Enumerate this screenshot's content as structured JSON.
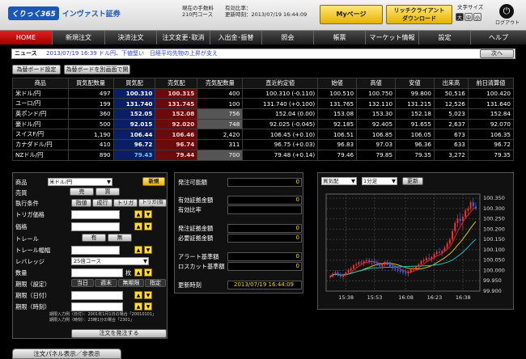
{
  "header": {
    "logo_mark": "くりっく365",
    "logo_text": "インヴァスト証券",
    "fee_label": "現在の手数料",
    "fee_value": "210円コース",
    "margin_label": "有効比率：",
    "updated_label": "更新時刻：2013/07/19 16:44:09",
    "mypage": "Myページ",
    "rich_client_1": "リッチクライアント",
    "rich_client_2": "ダウンロード",
    "font_size_label": "文字サイズ",
    "font_sizes": [
      "大",
      "中",
      "小"
    ],
    "logout": "ログアウト"
  },
  "nav": [
    {
      "label": "HOME"
    },
    {
      "label": "新規注文"
    },
    {
      "label": "決済注文"
    },
    {
      "label": "注文変更･取消"
    },
    {
      "label": "入出金･振替"
    },
    {
      "label": "照会"
    },
    {
      "label": "帳票"
    },
    {
      "label": "マーケット情報"
    },
    {
      "label": "設定"
    },
    {
      "label": "ヘルプ"
    }
  ],
  "news": {
    "label": "ニュース",
    "text": "2013/07/19 16:39 ドル円、下値堅い　日経平均先物の上昇が支え",
    "next": "次へ"
  },
  "board_buttons": [
    "為替ボード設定",
    "為替ボードを別画面で開く"
  ],
  "quotes": {
    "headers": [
      "商品",
      "買気配数量",
      "買気配",
      "売気配",
      "売気配数量",
      "直近約定値",
      "始値",
      "高値",
      "安値",
      "出来高",
      "前日清算値"
    ],
    "rows": [
      [
        "米ドル/円",
        "497",
        "100.310",
        "100.315",
        "400",
        "100.310 (-0.110)",
        "100.510",
        "100.750",
        "99.800",
        "50,516",
        "100.420"
      ],
      [
        "ユーロ/円",
        "199",
        "131.740",
        "131.745",
        "100",
        "131.740 (+0.100)",
        "131.765",
        "132.110",
        "131.215",
        "12,526",
        "131.640"
      ],
      [
        "英ポンド/円",
        "360",
        "152.05",
        "152.08",
        "756",
        "152.04 (0.00)",
        "153.08",
        "153.30",
        "152.18",
        "5,023",
        "152.84"
      ],
      [
        "豪ドル/円",
        "500",
        "92.015",
        "92.020",
        "748",
        "92.025 (-0.045)",
        "92.185",
        "92.405",
        "91.655",
        "2,637",
        "92.070"
      ],
      [
        "スイスF/円",
        "1,190",
        "106.44",
        "106.46",
        "2,420",
        "106.45 (+0.10)",
        "106.51",
        "106.85",
        "106.05",
        "673",
        "106.35"
      ],
      [
        "カナダドル/円",
        "410",
        "96.72",
        "96.74",
        "311",
        "96.75 (+0.03)",
        "96.83",
        "97.03",
        "96.36",
        "633",
        "96.72"
      ],
      [
        "NZドル/円",
        "890",
        "79.43",
        "79.44",
        "700",
        "79.48 (+0.14)",
        "79.46",
        "79.85",
        "79.35",
        "3,272",
        "79.35"
      ]
    ]
  },
  "order": {
    "product_label": "商品",
    "product_value": "米ドル/円",
    "new_button": "新規",
    "side_label": "売買",
    "sell": "売",
    "buy": "買",
    "exec_label": "執行条件",
    "exec_opts": [
      "指値",
      "成行",
      "トリガ",
      "トリガ(指値)"
    ],
    "trigger_label": "トリガ価格",
    "price_label": "価格",
    "trail_label": "トレール",
    "trail_opts": [
      "有",
      "無"
    ],
    "trail_width_label": "トレール幅幅",
    "leverage_label": "レバレッジ",
    "leverage_value": "25倍コース",
    "qty_label": "数量",
    "qty_unit": "枚",
    "period_set_label": "期限（設定）",
    "period_opts": [
      "当日",
      "週末",
      "無期限",
      "指定"
    ],
    "period_day_label": "期限（日付）",
    "period_time_label": "期限（時刻）",
    "note1": "期限入力例（日付）：2001年1月1日の場合「20010101」",
    "note2": "期限入力例（時刻）：23時1分の場合「2301」",
    "submit": "注文を発注する"
  },
  "account": {
    "orderable_label": "発注可能額",
    "orderable": "0",
    "eff_margin_label": "有効証拠金額",
    "eff_margin": "0",
    "eff_ratio_label": "有効比率",
    "order_margin_label": "発注証拠金額",
    "order_margin": "0",
    "req_margin_label": "必要証拠金額",
    "req_margin": "0",
    "alert_label": "アラート基準額",
    "alert": "0",
    "losscut_label": "ロスカット基準額",
    "losscut": "0",
    "updated_label": "更新時刻",
    "updated": "2013/07/19 16:44:09"
  },
  "chart": {
    "side": "買気配",
    "interval": "1分足",
    "update": "更新",
    "yticks": [
      "100.350",
      "100.300",
      "100.250",
      "100.200",
      "100.150",
      "100.100",
      "100.050",
      "100.000",
      "99.950",
      "99.900"
    ],
    "xticks": [
      "15:38",
      "15:53",
      "16:08",
      "16:23",
      "16:38"
    ]
  },
  "chart_data": {
    "type": "candlestick",
    "x_start": "15:30",
    "x_end": "16:44",
    "ylim": [
      99.9,
      100.37
    ],
    "candles": [
      [
        99.97,
        99.98,
        99.96,
        99.97
      ],
      [
        99.97,
        99.99,
        99.965,
        99.985
      ],
      [
        99.985,
        100.0,
        99.975,
        99.99
      ],
      [
        99.99,
        100.0,
        99.97,
        99.975
      ],
      [
        99.975,
        99.99,
        99.96,
        99.97
      ],
      [
        99.97,
        99.985,
        99.955,
        99.98
      ],
      [
        99.98,
        99.995,
        99.97,
        99.99
      ],
      [
        99.99,
        100.01,
        99.98,
        100.0
      ],
      [
        100.0,
        100.02,
        99.99,
        100.01
      ],
      [
        100.01,
        100.03,
        100.0,
        100.025
      ],
      [
        100.025,
        100.04,
        100.015,
        100.03
      ],
      [
        100.03,
        100.045,
        100.02,
        100.04
      ],
      [
        100.04,
        100.05,
        100.025,
        100.035
      ],
      [
        100.035,
        100.05,
        100.02,
        100.045
      ],
      [
        100.045,
        100.06,
        100.03,
        100.05
      ],
      [
        100.05,
        100.06,
        100.03,
        100.04
      ],
      [
        100.04,
        100.055,
        100.025,
        100.045
      ],
      [
        100.045,
        100.06,
        100.03,
        100.035
      ],
      [
        100.035,
        100.05,
        100.02,
        100.025
      ],
      [
        100.025,
        100.04,
        100.01,
        100.02
      ],
      [
        100.02,
        100.035,
        100.005,
        100.03
      ],
      [
        100.03,
        100.045,
        100.02,
        100.04
      ],
      [
        100.04,
        100.05,
        100.025,
        100.03
      ],
      [
        100.03,
        100.045,
        100.015,
        100.02
      ],
      [
        100.02,
        100.03,
        100.0,
        100.01
      ],
      [
        100.01,
        100.025,
        99.995,
        100.005
      ],
      [
        100.005,
        100.02,
        99.99,
        100.0
      ],
      [
        100.0,
        100.015,
        99.985,
        99.995
      ],
      [
        99.995,
        100.01,
        99.98,
        99.99
      ],
      [
        99.99,
        100.005,
        99.975,
        99.985
      ],
      [
        99.985,
        100.0,
        99.97,
        99.99
      ],
      [
        99.99,
        100.01,
        99.985,
        100.005
      ],
      [
        100.005,
        100.02,
        99.995,
        100.01
      ],
      [
        100.01,
        100.025,
        100.0,
        100.02
      ],
      [
        100.02,
        100.035,
        100.01,
        100.03
      ],
      [
        100.03,
        100.05,
        100.02,
        100.045
      ],
      [
        100.045,
        100.06,
        100.035,
        100.05
      ],
      [
        100.05,
        100.07,
        100.04,
        100.06
      ],
      [
        100.06,
        100.08,
        100.05,
        100.055
      ],
      [
        100.055,
        100.07,
        100.04,
        100.065
      ],
      [
        100.065,
        100.09,
        100.055,
        100.08
      ],
      [
        100.08,
        100.1,
        100.07,
        100.09
      ],
      [
        100.09,
        100.11,
        100.08,
        100.085
      ],
      [
        100.085,
        100.1,
        100.07,
        100.095
      ],
      [
        100.095,
        100.12,
        100.09,
        100.11
      ],
      [
        100.11,
        100.14,
        100.1,
        100.13
      ],
      [
        100.13,
        100.16,
        100.12,
        100.15
      ],
      [
        100.15,
        100.2,
        100.14,
        100.19
      ],
      [
        100.19,
        100.24,
        100.18,
        100.23
      ],
      [
        100.23,
        100.27,
        100.21,
        100.25
      ],
      [
        100.25,
        100.28,
        100.22,
        100.24
      ],
      [
        100.24,
        100.27,
        100.2,
        100.26
      ],
      [
        100.26,
        100.3,
        100.25,
        100.29
      ],
      [
        100.29,
        100.31,
        100.27,
        100.3
      ],
      [
        100.3,
        100.34,
        100.29,
        100.33
      ],
      [
        100.33,
        100.35,
        100.3,
        100.31
      ],
      [
        100.31,
        100.33,
        100.29,
        100.3
      ]
    ]
  },
  "footer": {
    "toggle": "注文パネル表示／非表示"
  }
}
